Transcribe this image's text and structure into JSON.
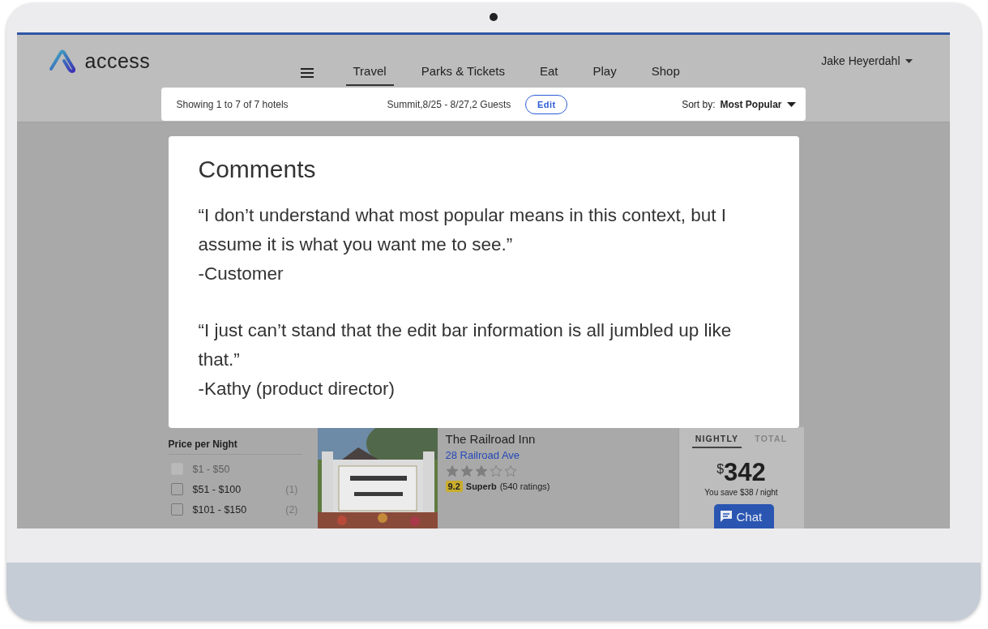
{
  "header": {
    "logo": "access",
    "nav": [
      {
        "label": "Travel",
        "selected": true
      },
      {
        "label": "Parks & Tickets",
        "selected": false
      },
      {
        "label": "Eat",
        "selected": false
      },
      {
        "label": "Play",
        "selected": false
      },
      {
        "label": "Shop",
        "selected": false
      }
    ],
    "user": "Jake Heyerdahl"
  },
  "search_bar": {
    "showing": "Showing 1 to 7 of 7 hotels",
    "trip": "Summit,8/25 - 8/27,2 Guests",
    "edit": "Edit",
    "sort_label": "Sort by:",
    "sort_value": "Most Popular"
  },
  "filters": {
    "title": "Price per Night",
    "options": [
      {
        "label": "$1 - $50",
        "checked": false,
        "disabled": true
      },
      {
        "label": "$51 - $100",
        "count": "(1)",
        "checked": false,
        "disabled": false
      },
      {
        "label": "$101 - $150",
        "count": "(2)",
        "checked": false,
        "disabled": false
      }
    ]
  },
  "hotel": {
    "name": "The Railroad Inn",
    "address": "28 Railroad Ave",
    "stars": 3,
    "score": "9.2",
    "rating_word": "Superb",
    "ratings": "(540 ratings)"
  },
  "price": {
    "tabs": [
      {
        "label": "NIGHTLY",
        "selected": true
      },
      {
        "label": "TOTAL",
        "selected": false
      }
    ],
    "currency": "$",
    "amount": "342",
    "savings": "You save $38 / night"
  },
  "chat": {
    "label": "Chat"
  },
  "modal": {
    "title": "Comments",
    "quotes": [
      {
        "text": "“I don’t understand what most popular means in this context, but I assume it is what you want me to see.”",
        "author": "-Customer"
      },
      {
        "text": "“I just can’t stand that the edit bar information is all jumbled up like that.”",
        "author": "-Kathy (product director)"
      }
    ]
  }
}
